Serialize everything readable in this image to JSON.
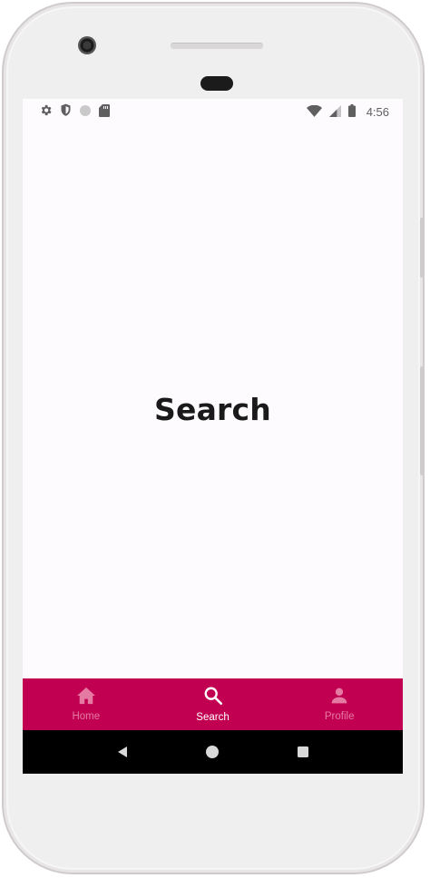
{
  "status_bar": {
    "time": "4:56",
    "left_icons": [
      "settings-icon",
      "shield-icon",
      "circle-icon",
      "sd-card-icon"
    ],
    "right_icons": [
      "wifi-icon",
      "signal-icon",
      "battery-icon"
    ]
  },
  "page": {
    "title": "Search"
  },
  "bottom_nav": {
    "background": "#c20052",
    "active_color": "#ffffff",
    "inactive_color": "#e57aa3",
    "items": [
      {
        "label": "Home",
        "icon": "home-icon",
        "active": false
      },
      {
        "label": "Search",
        "icon": "search-icon",
        "active": true
      },
      {
        "label": "Profile",
        "icon": "person-icon",
        "active": false
      }
    ]
  },
  "system_nav": {
    "buttons": [
      "back-icon",
      "home-circle-icon",
      "recents-icon"
    ]
  }
}
